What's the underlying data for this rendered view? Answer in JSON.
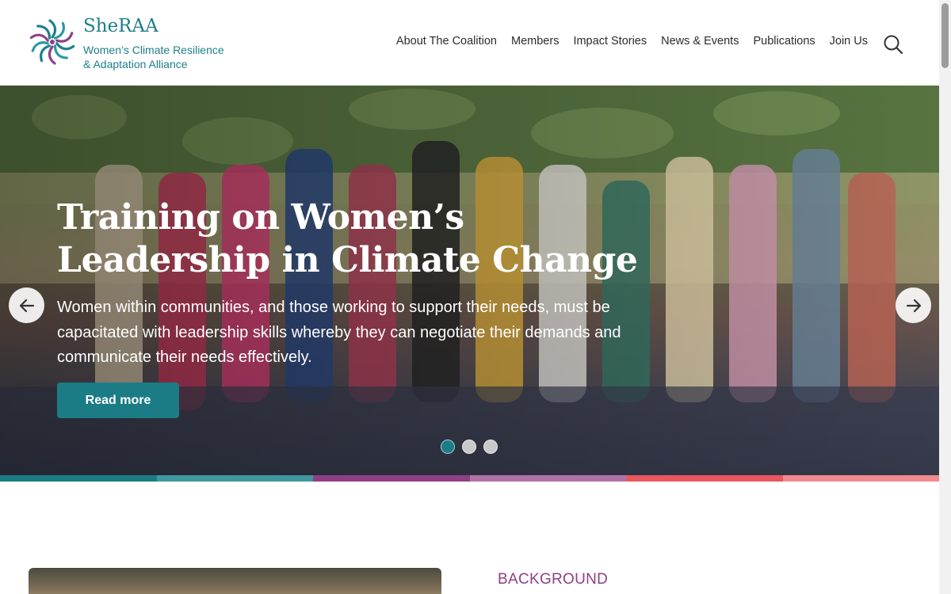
{
  "brand": {
    "name": "SheRAA",
    "tagline_line1": "Women’s Climate Resilience",
    "tagline_line2": "& Adaptation Alliance",
    "color": "#1d7f8a"
  },
  "nav": {
    "items": [
      {
        "label": "About The Coalition"
      },
      {
        "label": "Members"
      },
      {
        "label": "Impact Stories"
      },
      {
        "label": "News & Events"
      },
      {
        "label": "Publications"
      },
      {
        "label": "Join Us"
      }
    ],
    "search_icon": "search-icon"
  },
  "hero": {
    "title_line1": "Training on Women’s",
    "title_line2": "Leadership in Climate Change",
    "text": "Women within communities, and those working to support their needs, must be capacitated with leadership skills whereby they can negotiate their demands and communicate their needs effectively.",
    "button_label": "Read more",
    "prev_icon": "arrow-left-icon",
    "next_icon": "arrow-right-icon",
    "slide_count": 3,
    "active_slide": 1,
    "accent": "#1b7c86"
  },
  "strip_colors": [
    "#1b7c86",
    "#3f97a0",
    "#8e3f86",
    "#b071a7",
    "#e8575e",
    "#f08a8e"
  ],
  "section": {
    "label": "BACKGROUND",
    "label_color": "#8e3f86"
  }
}
